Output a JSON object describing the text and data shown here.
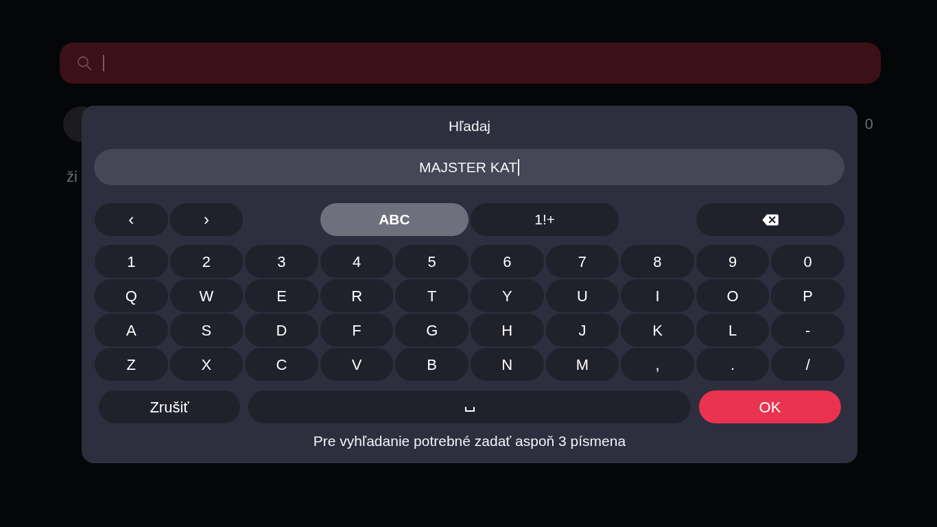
{
  "search_bar": {
    "cursor": true
  },
  "filter_row": {
    "trailing_text": "0"
  },
  "list": {
    "item_text": "ži"
  },
  "dialog": {
    "title": "Hľadaj",
    "input": {
      "value": "MAJSTER KAT",
      "cursor": true
    },
    "cursor_keys": [
      "‹",
      "›"
    ],
    "modes": [
      {
        "label": "ABC",
        "selected": true
      },
      {
        "label": "1!+",
        "selected": false
      }
    ],
    "key_rows": [
      [
        "1",
        "2",
        "3",
        "4",
        "5",
        "6",
        "7",
        "8",
        "9",
        "0"
      ],
      [
        "Q",
        "W",
        "E",
        "R",
        "T",
        "Y",
        "U",
        "I",
        "O",
        "P"
      ],
      [
        "A",
        "S",
        "D",
        "F",
        "G",
        "H",
        "J",
        "K",
        "L",
        "-"
      ],
      [
        "Z",
        "X",
        "C",
        "V",
        "B",
        "N",
        "M",
        ",",
        ".",
        "/"
      ]
    ],
    "cancel_button": "Zrušiť",
    "ok_button": "OK",
    "hint": "Pre vyhľadanie potrebné zadať aspoň 3 písmena"
  }
}
